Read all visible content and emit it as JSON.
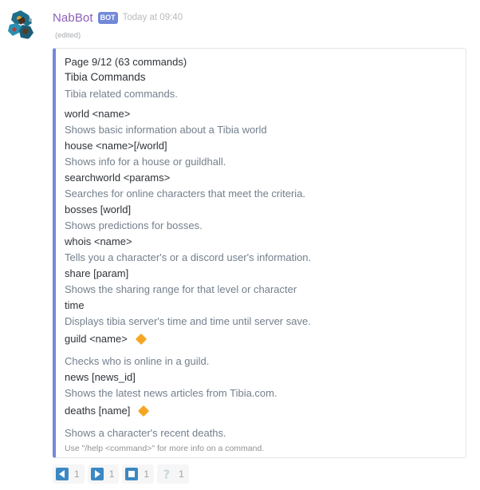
{
  "message": {
    "username": "NabBot",
    "bot_tag": "BOT",
    "timestamp": "Today at 09:40",
    "edited": "(edited)"
  },
  "embed": {
    "author": "Page 9/12 (63 commands)",
    "title": "Tibia Commands",
    "description": "Tibia related commands.",
    "accent_color": "#7289da",
    "fields": [
      {
        "name": "world <name>",
        "value": "Shows basic information about a Tibia world",
        "badge": false
      },
      {
        "name": "house <name>[/world]",
        "value": "Shows info for a house or guildhall.",
        "badge": false
      },
      {
        "name": "searchworld <params>",
        "value": "Searches for online characters that meet the criteria.",
        "badge": false
      },
      {
        "name": "bosses [world]",
        "value": "Shows predictions for bosses.",
        "badge": false
      },
      {
        "name": "whois <name>",
        "value": "Tells you a character's or a discord user's information.",
        "badge": false
      },
      {
        "name": "share [param]",
        "value": "Shows the sharing range for that level or character",
        "badge": false
      },
      {
        "name": "time",
        "value": "Displays tibia server's time and time until server save.",
        "badge": false
      },
      {
        "name": "guild <name>",
        "value": "Checks who is online in a guild.",
        "badge": true
      },
      {
        "name": "news [news_id]",
        "value": "Shows the latest news articles from Tibia.com.",
        "badge": false
      },
      {
        "name": "deaths [name]",
        "value": "Shows a character's recent deaths.",
        "badge": true
      }
    ],
    "footer": "Use \"/help <command>\" for more info on a command."
  },
  "reactions": [
    {
      "icon": "previous-page-icon",
      "count": "1"
    },
    {
      "icon": "next-page-icon",
      "count": "1"
    },
    {
      "icon": "stop-icon",
      "count": "1"
    },
    {
      "icon": "help-icon",
      "count": "1"
    }
  ]
}
